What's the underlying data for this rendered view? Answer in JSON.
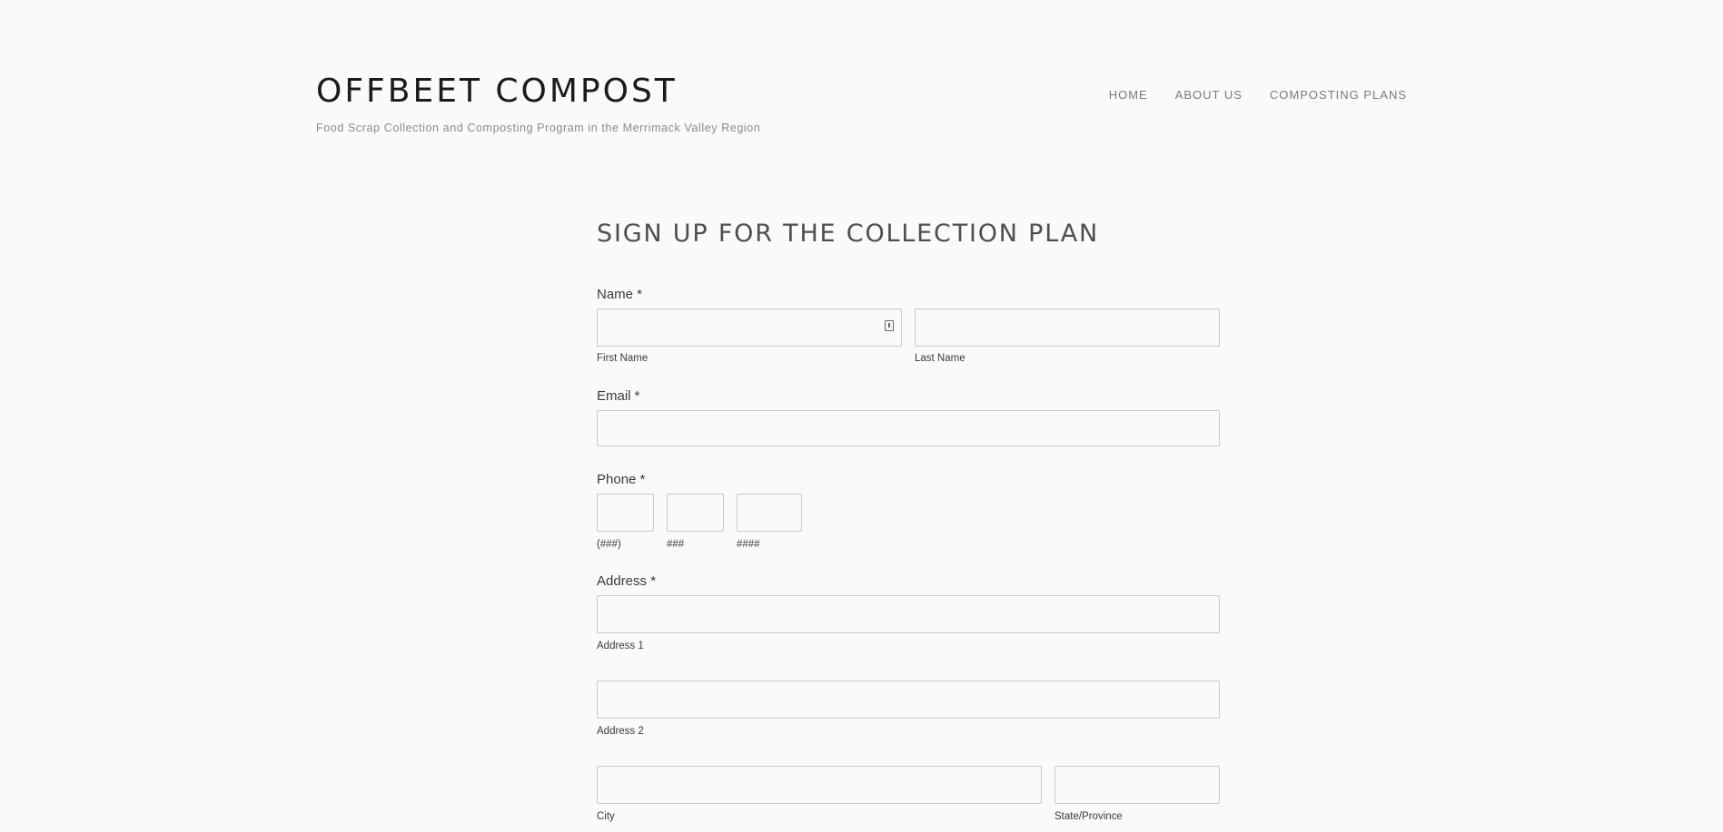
{
  "header": {
    "title": "OFFBEET COMPOST",
    "tagline": "Food Scrap Collection and Composting Program in the Merrimack Valley Region",
    "nav": [
      {
        "label": "HOME"
      },
      {
        "label": "ABOUT US"
      },
      {
        "label": "COMPOSTING PLANS"
      }
    ]
  },
  "form": {
    "title": "SIGN UP FOR THE COLLECTION PLAN",
    "name": {
      "label": "Name *",
      "first_label": "First Name",
      "last_label": "Last Name",
      "first_value": "",
      "last_value": ""
    },
    "email": {
      "label": "Email *",
      "value": ""
    },
    "phone": {
      "label": "Phone *",
      "area_label": "(###)",
      "prefix_label": "###",
      "line_label": "####"
    },
    "address": {
      "label": "Address *",
      "address1_label": "Address 1",
      "address2_label": "Address 2",
      "city_label": "City",
      "state_label": "State/Province"
    }
  },
  "icons": {
    "autofill": "contact-card-icon"
  }
}
